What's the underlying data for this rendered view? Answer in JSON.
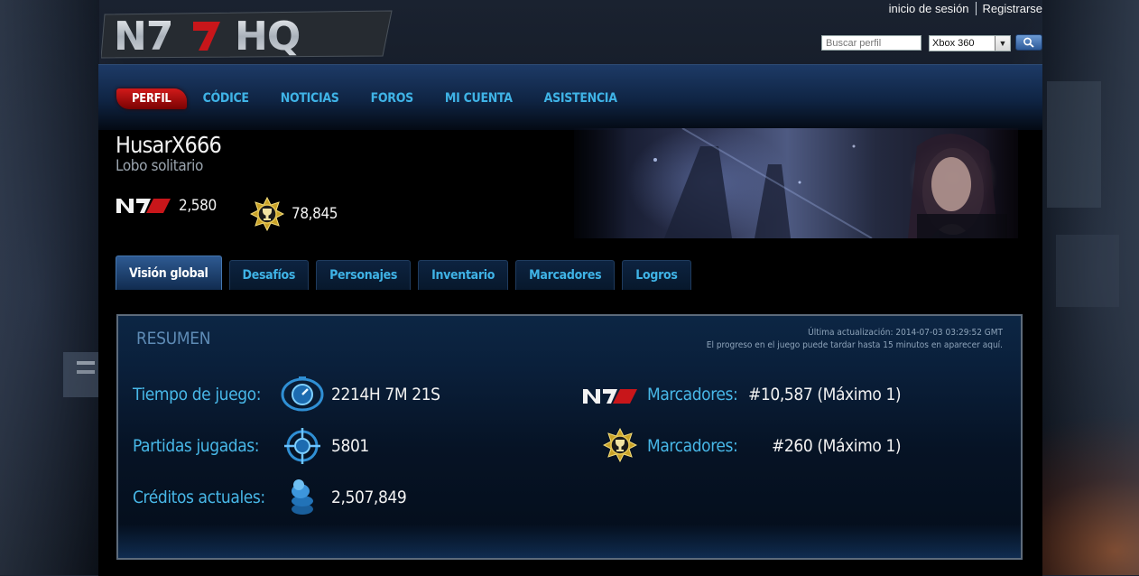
{
  "header": {
    "logo_text": "N7 HQ",
    "login_link": "inicio de sesión",
    "register_link": "Registrarse",
    "search_placeholder": "Buscar perfil",
    "platform_selected": "Xbox 360"
  },
  "nav": {
    "items": [
      {
        "label": "PERFIL",
        "active": true
      },
      {
        "label": "CÓDICE"
      },
      {
        "label": "NOTICIAS"
      },
      {
        "label": "FOROS"
      },
      {
        "label": "MI CUENTA"
      },
      {
        "label": "ASISTENCIA"
      }
    ]
  },
  "profile": {
    "username": "HusarX666",
    "title": "Lobo solitario",
    "n7_rating": "2,580",
    "challenge_points": "78,845"
  },
  "tabs": [
    {
      "label": "Visión global",
      "active": true
    },
    {
      "label": "Desafíos"
    },
    {
      "label": "Personajes"
    },
    {
      "label": "Inventario"
    },
    {
      "label": "Marcadores"
    },
    {
      "label": "Logros"
    }
  ],
  "summary": {
    "title": "RESUMEN",
    "last_update": "Última actualización: 2014-07-03 03:29:52 GMT",
    "delay_note": "El progreso en el juego puede tardar hasta 15 minutos en aparecer aquí.",
    "playtime_label": "Tiempo de juego:",
    "playtime_value": "2214H 7M 21S",
    "games_label": "Partidas jugadas:",
    "games_value": "5801",
    "credits_label": "Créditos actuales:",
    "credits_value": "2,507,849",
    "n7_leaderboard_label": "Marcadores:",
    "n7_leaderboard_value": "#10,587 (Máximo 1)",
    "challenge_leaderboard_label": "Marcadores:",
    "challenge_leaderboard_value": "#260 (Máximo 1)"
  },
  "icons": {
    "n7": "n7-logo-icon",
    "challenge": "challenge-medal-icon",
    "playtime": "stopwatch-icon",
    "games": "crosshair-icon",
    "credits": "credits-icon",
    "search": "search-icon"
  },
  "colors": {
    "accent": "#3fb3e6",
    "active_nav": "#c0110f",
    "panel_bg": "#000000"
  }
}
